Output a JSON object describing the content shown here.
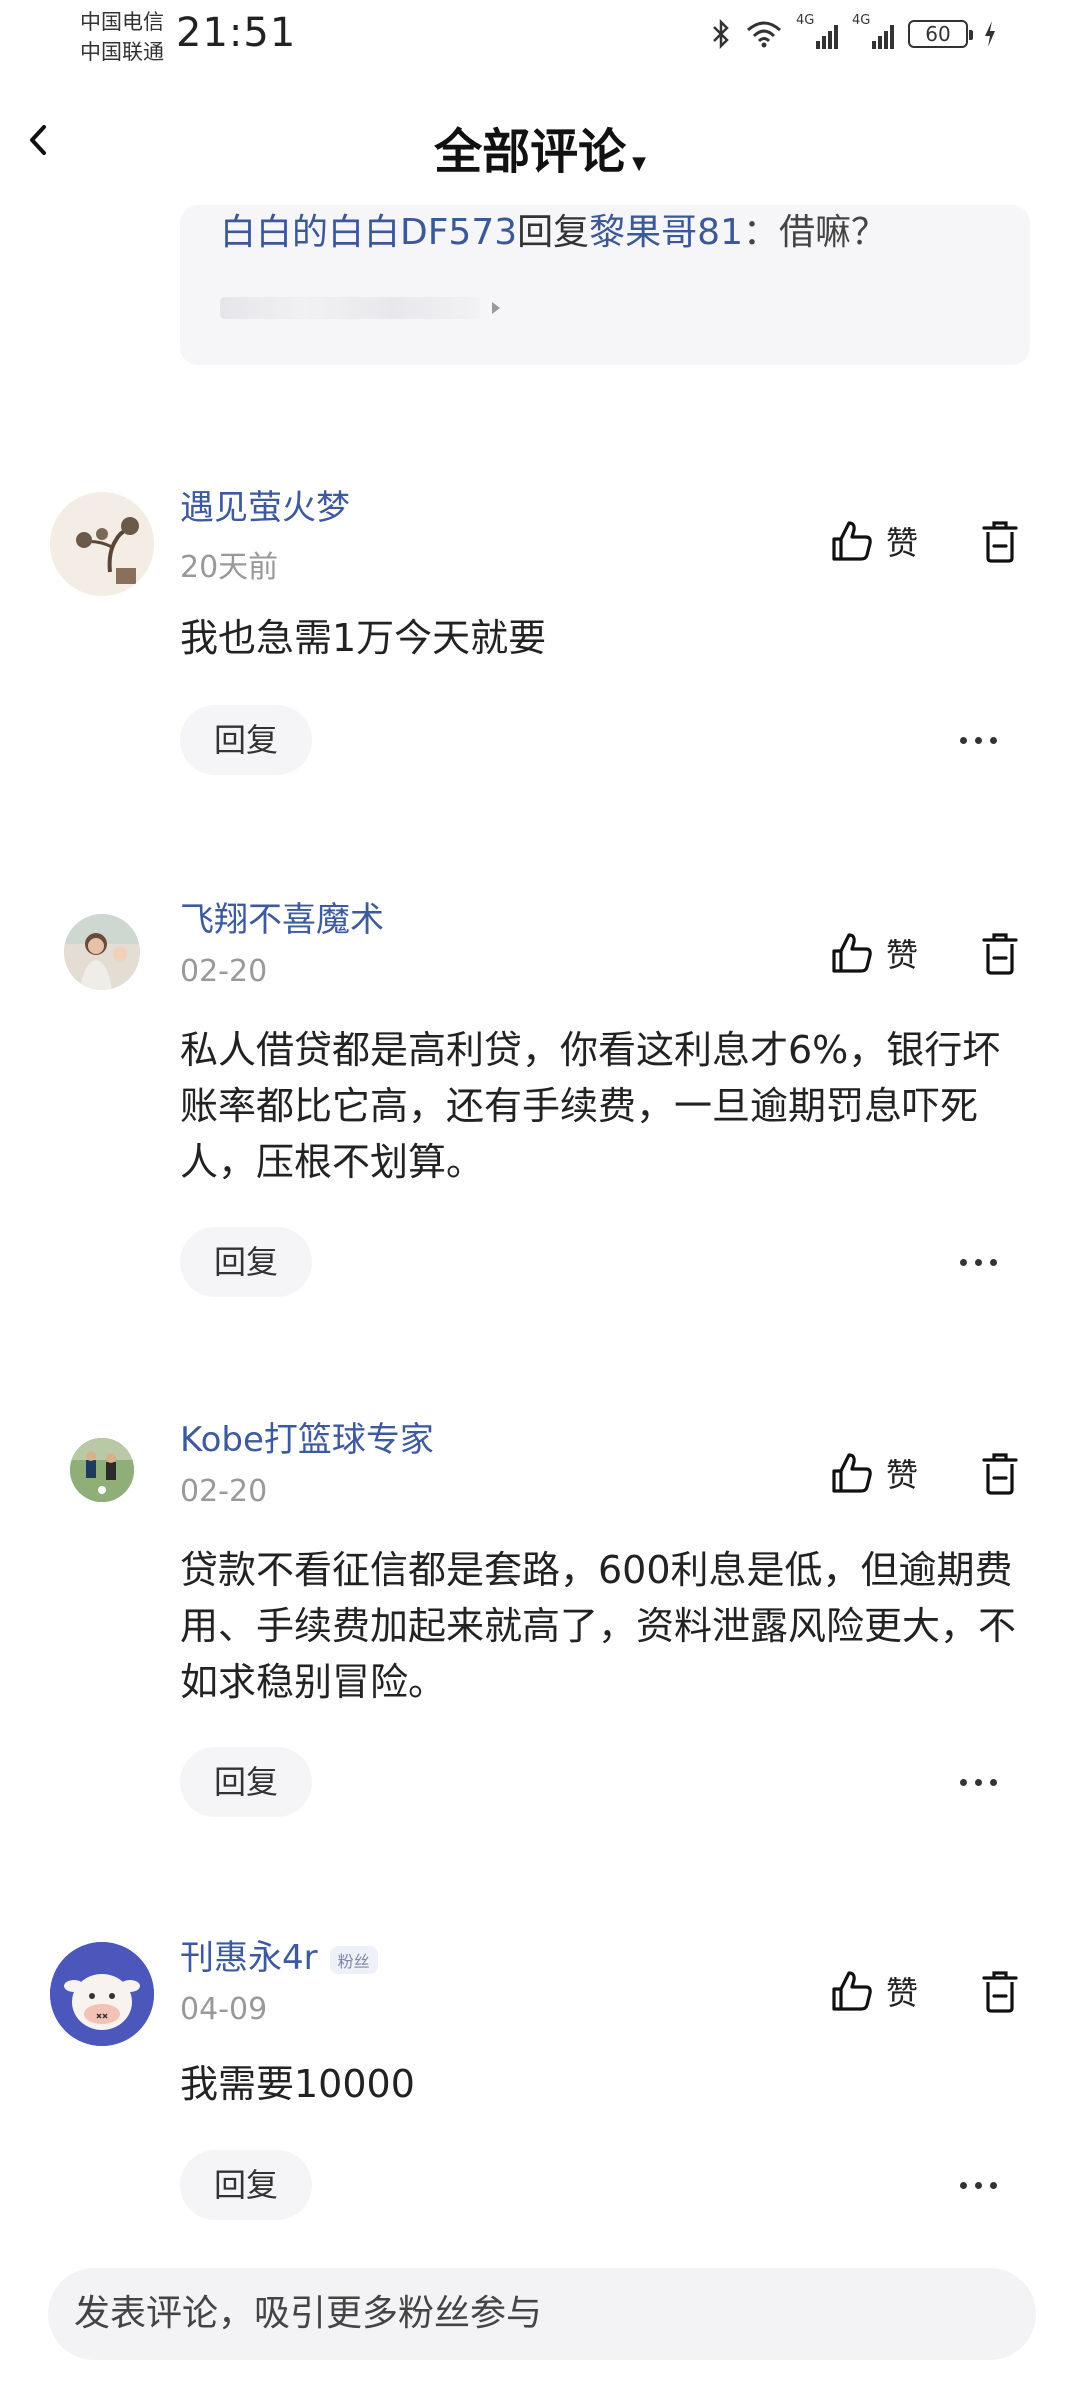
{
  "status_bar": {
    "carrier1": "中国电信",
    "carrier2": "中国联通",
    "time": "21:51",
    "battery": "60",
    "signal1": "4G",
    "signal2": "4G"
  },
  "header": {
    "title": "全部评论"
  },
  "quoted_reply": {
    "from_user": "白白的白白DF573",
    "connector": "回复",
    "to_user": "黎果哥81",
    "message": "：借嘛？"
  },
  "comments": [
    {
      "user": "遇见萤火梦",
      "time": "20天前",
      "text": "我也急需1万今天就要",
      "like_label": "赞",
      "reply_label": "回复"
    },
    {
      "user": "飞翔不喜魔术",
      "time": "02-20",
      "text": "私人借贷都是高利贷，你看这利息才6%，银行坏账率都比它高，还有手续费，一旦逾期罚息吓死人，压根不划算。",
      "like_label": "赞",
      "reply_label": "回复"
    },
    {
      "user": "Kobe打篮球专家",
      "time": "02-20",
      "text": "贷款不看征信都是套路，600利息是低，但逾期费用、手续费加起来就高了，资料泄露风险更大，不如求稳别冒险。",
      "like_label": "赞",
      "reply_label": "回复"
    },
    {
      "user": "刊惠永4r",
      "badge": "粉丝",
      "time": "04-09",
      "text": "我需要10000",
      "like_label": "赞",
      "reply_label": "回复"
    }
  ],
  "input": {
    "placeholder": "发表评论，吸引更多粉丝参与"
  },
  "colors": {
    "username": "#3d5a9e",
    "time": "#999999",
    "bubble_bg": "#f5f5f7"
  }
}
